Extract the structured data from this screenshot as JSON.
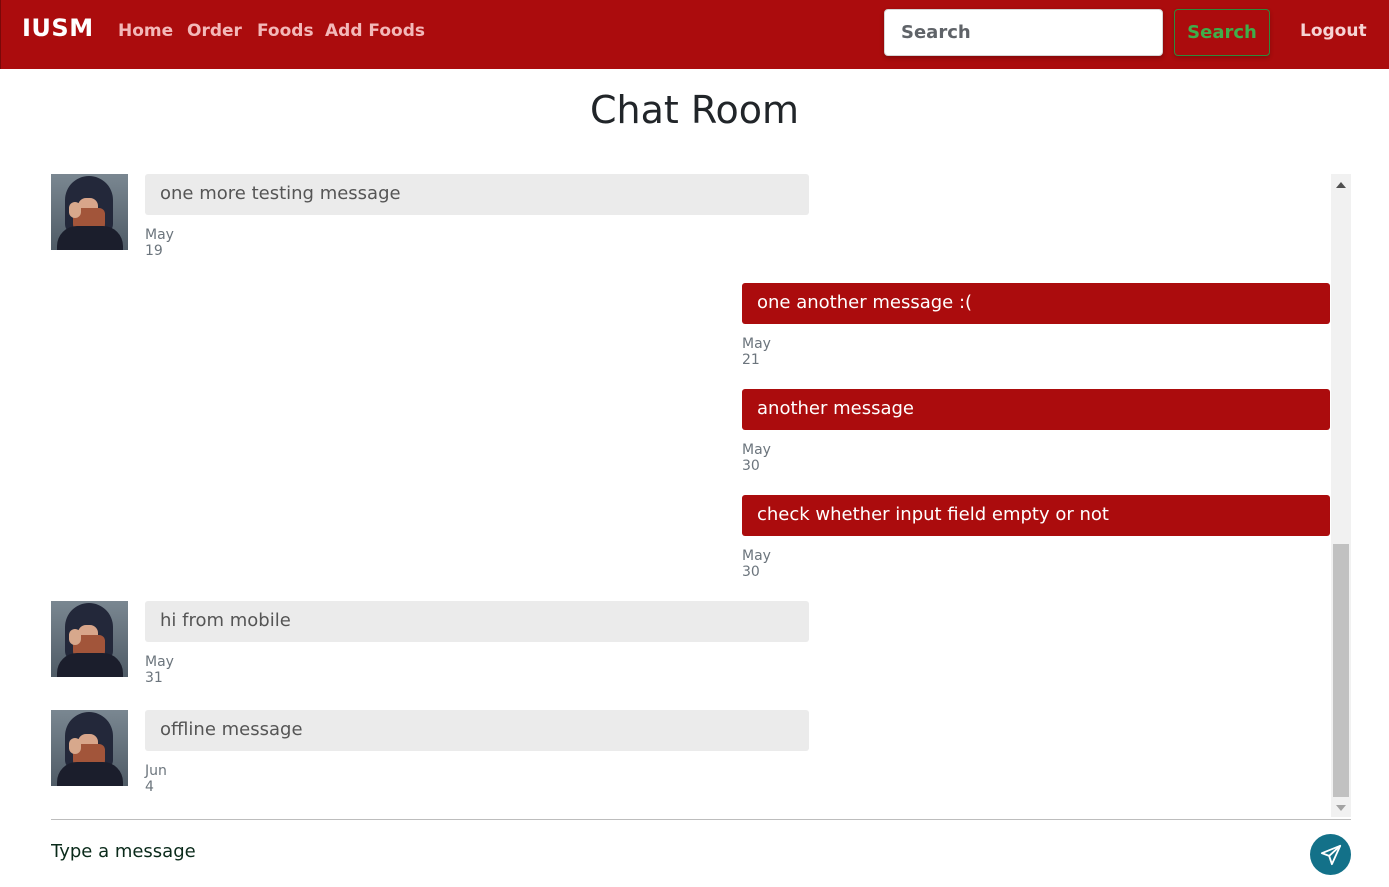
{
  "navbar": {
    "brand": "IUSM",
    "links": [
      "Home",
      "Order",
      "Foods",
      "Add Foods"
    ],
    "search_placeholder": "Search",
    "search_button": "Search",
    "logout": "Logout"
  },
  "page": {
    "title": "Chat Room"
  },
  "messages": [
    {
      "direction": "incoming",
      "text": "one more testing message",
      "date": "May 19"
    },
    {
      "direction": "outgoing",
      "text": "one another message :(",
      "date": "May 21"
    },
    {
      "direction": "outgoing",
      "text": "another message",
      "date": "May 30"
    },
    {
      "direction": "outgoing",
      "text": "check whether input field empty or not",
      "date": "May 30"
    },
    {
      "direction": "incoming",
      "text": "hi from mobile",
      "date": "May 31"
    },
    {
      "direction": "incoming",
      "text": "offline message",
      "date": "Jun 4"
    }
  ],
  "composer": {
    "placeholder": "Type a message",
    "send_icon": "paper-plane-icon"
  },
  "colors": {
    "navbar": "#ab0c0d",
    "outgoing_bubble": "#ab0c0d",
    "incoming_bubble": "#ebebeb",
    "search_button": "#3fae4a",
    "send_button": "#137189"
  }
}
